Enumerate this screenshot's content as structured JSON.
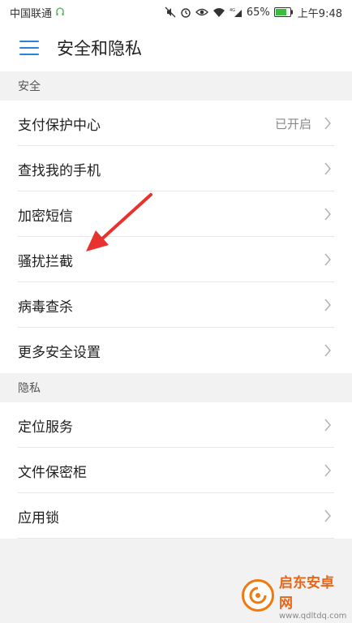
{
  "status_bar": {
    "carrier": "中国联通",
    "battery_percent": "65%",
    "time": "上午9:48",
    "network": "4G"
  },
  "app_bar": {
    "title": "安全和隐私"
  },
  "sections": [
    {
      "header": "安全",
      "items": [
        {
          "label": "支付保护中心",
          "value": "已开启"
        },
        {
          "label": "查找我的手机",
          "value": ""
        },
        {
          "label": "加密短信",
          "value": ""
        },
        {
          "label": "骚扰拦截",
          "value": ""
        },
        {
          "label": "病毒查杀",
          "value": ""
        },
        {
          "label": "更多安全设置",
          "value": ""
        }
      ]
    },
    {
      "header": "隐私",
      "items": [
        {
          "label": "定位服务",
          "value": ""
        },
        {
          "label": "文件保密柜",
          "value": ""
        },
        {
          "label": "应用锁",
          "value": ""
        }
      ]
    }
  ],
  "watermark": {
    "name": "启东安卓网",
    "url": "www.qdltdq.com"
  },
  "colors": {
    "accent": "#2a83d8",
    "annotation_arrow": "#e8322d"
  }
}
